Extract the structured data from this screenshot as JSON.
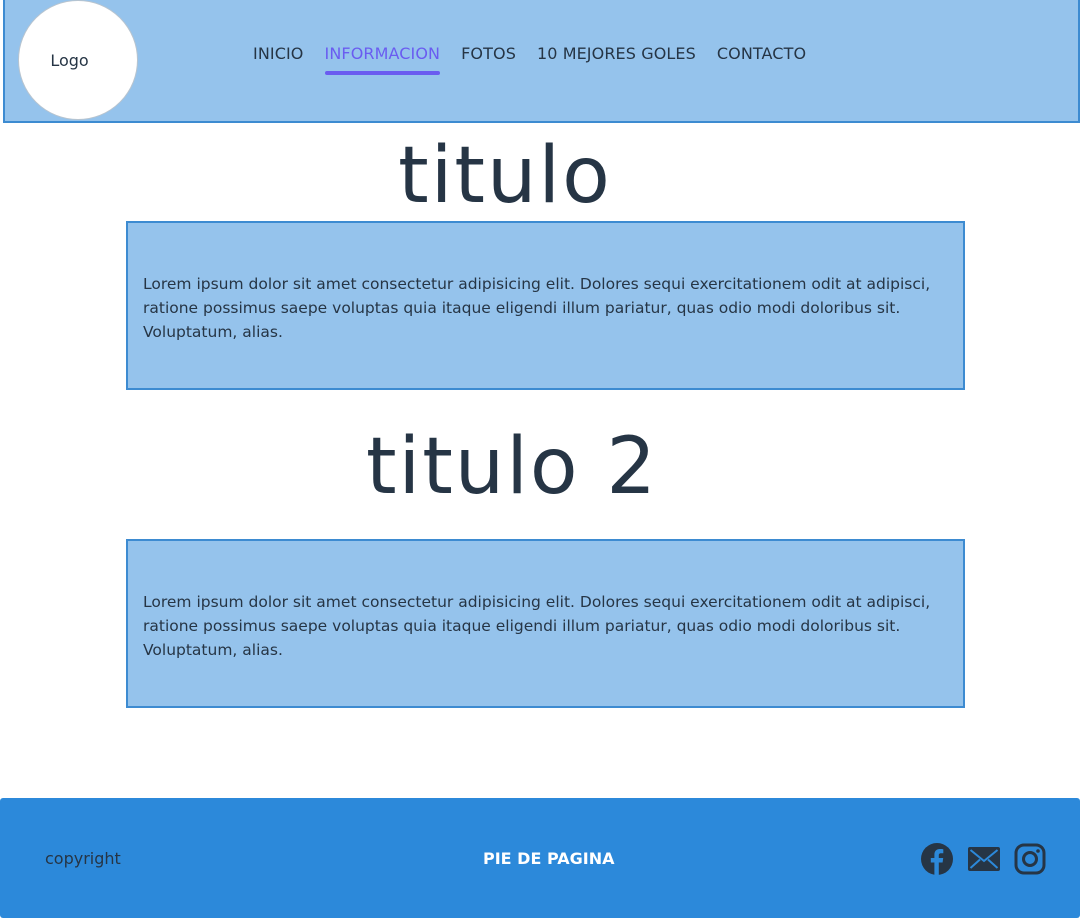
{
  "header": {
    "logo_label": "Logo",
    "nav": [
      {
        "label": "INICIO",
        "active": false
      },
      {
        "label": "INFORMACION",
        "active": true
      },
      {
        "label": "FOTOS",
        "active": false
      },
      {
        "label": "10 MEJORES GOLES",
        "active": false
      },
      {
        "label": "CONTACTO",
        "active": false
      }
    ]
  },
  "sections": [
    {
      "title": "titulo",
      "body": "Lorem ipsum dolor sit amet consectetur adipisicing elit. Dolores sequi exercitationem odit at adipisci, ratione possimus saepe voluptas quia itaque eligendi illum pariatur, quas odio modi doloribus sit. Voluptatum, alias."
    },
    {
      "title": "titulo 2",
      "body": "Lorem ipsum dolor sit amet consectetur adipisicing elit. Dolores sequi exercitationem odit at adipisci, ratione possimus saepe voluptas quia itaque eligendi illum pariatur, quas odio modi doloribus sit. Voluptatum, alias."
    }
  ],
  "footer": {
    "copyright": "copyright",
    "title": "PIE DE PAGINA",
    "social_icons": [
      "facebook-icon",
      "mail-icon",
      "instagram-icon"
    ]
  },
  "colors": {
    "header_bg": "#95c3ec",
    "border": "#3d8bd1",
    "nav_active": "#6a5cf0",
    "footer_bg": "#2c89da",
    "text": "#263545"
  }
}
